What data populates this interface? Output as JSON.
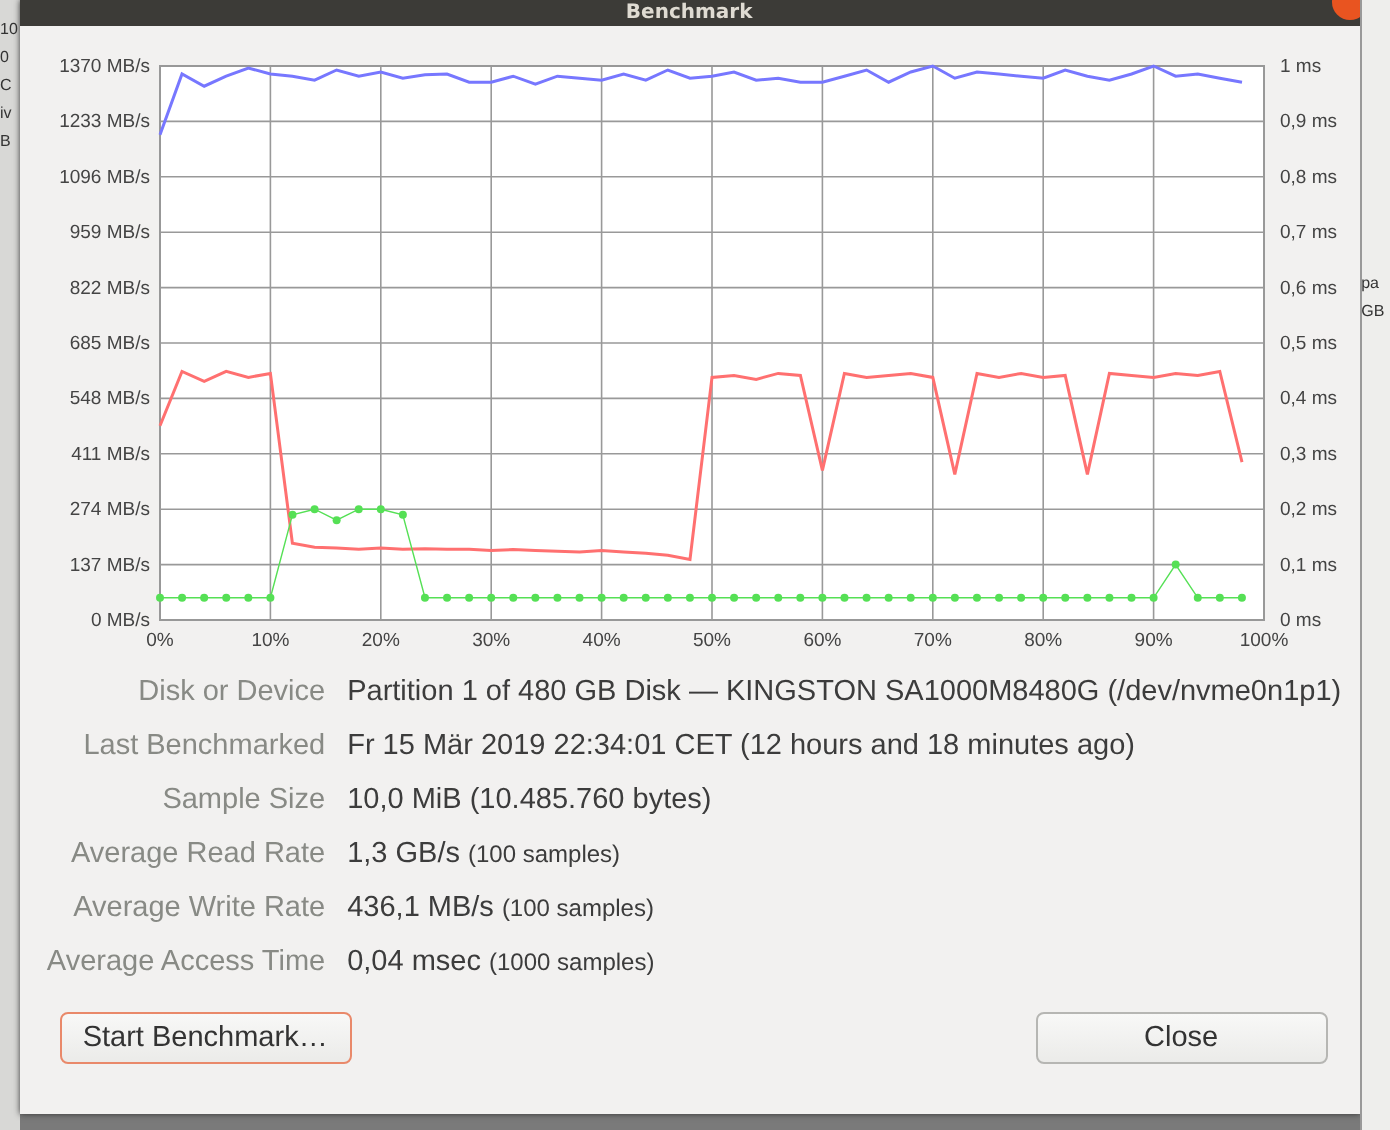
{
  "background_window": {
    "left_fragments": [
      "10",
      "0",
      "C",
      "iv",
      "B"
    ],
    "right_fragments": [
      "pa",
      "GB"
    ]
  },
  "window": {
    "title": "Benchmark"
  },
  "chart": {
    "chart_data": {
      "type": "line",
      "x": [
        0,
        2,
        4,
        6,
        8,
        10,
        12,
        14,
        16,
        18,
        20,
        22,
        24,
        26,
        28,
        30,
        32,
        34,
        36,
        38,
        40,
        42,
        44,
        46,
        48,
        50,
        52,
        54,
        56,
        58,
        60,
        62,
        64,
        66,
        68,
        70,
        72,
        74,
        76,
        78,
        80,
        82,
        84,
        86,
        88,
        90,
        92,
        94,
        96,
        98
      ],
      "xlim": [
        0,
        100
      ],
      "ylim": [
        0,
        1370
      ],
      "y2lim": [
        0,
        1
      ],
      "grid": true,
      "y2ticks": [
        {
          "value": 0,
          "label": "0 ms"
        },
        {
          "value": 0.1,
          "label": "0,1 ms"
        },
        {
          "value": 0.2,
          "label": "0,2 ms"
        },
        {
          "value": 0.3,
          "label": "0,3 ms"
        },
        {
          "value": 0.4,
          "label": "0,4 ms"
        },
        {
          "value": 0.5,
          "label": "0,5 ms"
        },
        {
          "value": 0.6,
          "label": "0,6 ms"
        },
        {
          "value": 0.7,
          "label": "0,7 ms"
        },
        {
          "value": 0.8,
          "label": "0,8 ms"
        },
        {
          "value": 0.9,
          "label": "0,9 ms"
        },
        {
          "value": 1,
          "label": "1 ms"
        }
      ],
      "xticks": [
        {
          "value": 0,
          "label": "0%"
        },
        {
          "value": 10,
          "label": "10%"
        },
        {
          "value": 20,
          "label": "20%"
        },
        {
          "value": 30,
          "label": "30%"
        },
        {
          "value": 40,
          "label": "40%"
        },
        {
          "value": 50,
          "label": "50%"
        },
        {
          "value": 60,
          "label": "60%"
        },
        {
          "value": 70,
          "label": "70%"
        },
        {
          "value": 80,
          "label": "80%"
        },
        {
          "value": 90,
          "label": "90%"
        },
        {
          "value": 100,
          "label": "100%"
        }
      ],
      "yticks": [
        {
          "value": 0,
          "label": "0 MB/s"
        },
        {
          "value": 137,
          "label": "137 MB/s"
        },
        {
          "value": 274,
          "label": "274 MB/s"
        },
        {
          "value": 411,
          "label": "411 MB/s"
        },
        {
          "value": 548,
          "label": "548 MB/s"
        },
        {
          "value": 685,
          "label": "685 MB/s"
        },
        {
          "value": 822,
          "label": "822 MB/s"
        },
        {
          "value": 959,
          "label": "959 MB/s"
        },
        {
          "value": 1096,
          "label": "1096 MB/s"
        },
        {
          "value": 1233,
          "label": "1233 MB/s"
        },
        {
          "value": 1370,
          "label": "1370 MB/s"
        }
      ],
      "series": [
        {
          "color": "#7777ff",
          "values": [
            1200,
            1350,
            1320,
            1345,
            1365,
            1350,
            1345,
            1335,
            1360,
            1345,
            1355,
            1340,
            1348,
            1350,
            1330,
            1330,
            1345,
            1325,
            1345,
            1340,
            1335,
            1350,
            1335,
            1360,
            1340,
            1345,
            1355,
            1335,
            1340,
            1330,
            1330,
            1345,
            1360,
            1330,
            1355,
            1370,
            1340,
            1355,
            1350,
            1345,
            1340,
            1360,
            1345,
            1335,
            1350,
            1370,
            1345,
            1350,
            1340,
            1330
          ]
        },
        {
          "color": "#ff7070",
          "values": [
            480,
            615,
            590,
            615,
            600,
            610,
            190,
            180,
            178,
            175,
            178,
            175,
            176,
            175,
            175,
            172,
            174,
            172,
            170,
            168,
            172,
            168,
            165,
            160,
            150,
            600,
            605,
            595,
            610,
            605,
            370,
            610,
            600,
            605,
            610,
            600,
            360,
            610,
            600,
            610,
            600,
            605,
            360,
            610,
            605,
            600,
            610,
            605,
            615,
            390
          ]
        },
        {
          "axis": "y2",
          "marker": "circle",
          "color": "#55e055",
          "values": [
            0.04,
            0.04,
            0.04,
            0.04,
            0.04,
            0.04,
            0.19,
            0.2,
            0.18,
            0.2,
            0.2,
            0.19,
            0.04,
            0.04,
            0.04,
            0.04,
            0.04,
            0.04,
            0.04,
            0.04,
            0.04,
            0.04,
            0.04,
            0.04,
            0.04,
            0.04,
            0.04,
            0.04,
            0.04,
            0.04,
            0.04,
            0.04,
            0.04,
            0.04,
            0.04,
            0.04,
            0.04,
            0.04,
            0.04,
            0.04,
            0.04,
            0.04,
            0.04,
            0.04,
            0.04,
            0.04,
            0.1,
            0.04,
            0.04,
            0.04
          ]
        }
      ]
    }
  },
  "details": [
    {
      "label": "Disk or Device",
      "value": "Partition 1 of 480 GB Disk — KINGSTON SA1000M8480G (/dev/nvme0n1p1)"
    },
    {
      "label": "Last Benchmarked",
      "value": "Fr 15 Mär 2019 22:34:01 CET (12 hours and 18 minutes ago)"
    },
    {
      "label": "Sample Size",
      "value": "10,0 MiB (10.485.760 bytes)"
    },
    {
      "label": "Average Read Rate",
      "value": "1,3 GB/s",
      "note": "(100 samples)"
    },
    {
      "label": "Average Write Rate",
      "value": "436,1 MB/s",
      "note": "(100 samples)"
    },
    {
      "label": "Average Access Time",
      "value": "0,04 msec",
      "note": "(1000 samples)"
    }
  ],
  "buttons": [
    {
      "label": "Start Benchmark…",
      "kind": "suggested"
    },
    {
      "label": "Close",
      "kind": "normal"
    }
  ]
}
